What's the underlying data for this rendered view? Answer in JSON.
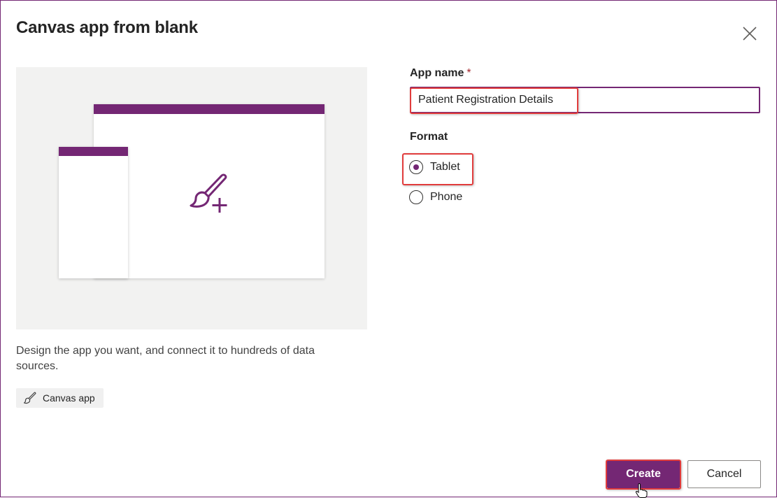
{
  "dialog": {
    "title": "Canvas app from blank",
    "close_icon": "close-icon"
  },
  "illustration": {
    "icon": "paintbrush-plus-icon",
    "accent_color": "#742774",
    "background_color": "#f2f2f1"
  },
  "description": "Design the app you want, and connect it to hundreds of data sources.",
  "tag": {
    "icon": "paintbrush-icon",
    "label": "Canvas app"
  },
  "form": {
    "app_name_label": "App name",
    "required_marker": "*",
    "app_name_value": "Patient Registration Details",
    "format_label": "Format",
    "format_options": [
      {
        "label": "Tablet",
        "selected": true
      },
      {
        "label": "Phone",
        "selected": false
      }
    ]
  },
  "buttons": {
    "create_label": "Create",
    "cancel_label": "Cancel"
  },
  "colors": {
    "brand": "#742774",
    "highlight": "#e13c3c",
    "required": "#a4262c"
  }
}
